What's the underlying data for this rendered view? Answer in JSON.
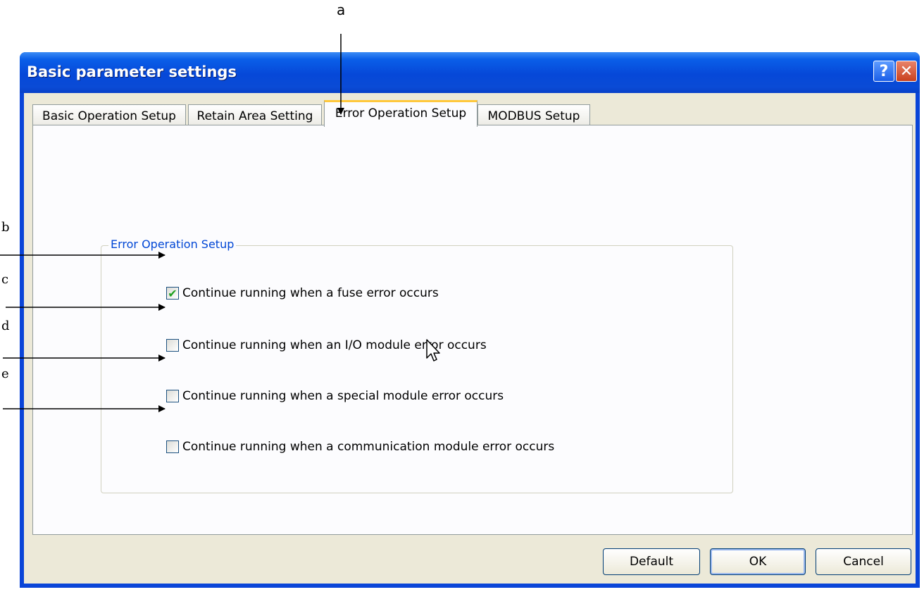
{
  "callouts": {
    "a": "a",
    "b": "b",
    "c": "c",
    "d": "d",
    "e": "e"
  },
  "window": {
    "title": "Basic parameter settings",
    "help_icon": "?",
    "close_icon": "✕"
  },
  "tabs": [
    {
      "label": "Basic Operation Setup",
      "active": false
    },
    {
      "label": "Retain Area Setting",
      "active": false
    },
    {
      "label": "Error Operation Setup",
      "active": true
    },
    {
      "label": "MODBUS Setup",
      "active": false
    }
  ],
  "group": {
    "title": "Error Operation Setup",
    "options": [
      {
        "label": "Continue running when a fuse error occurs",
        "checked": true
      },
      {
        "label": "Continue running when an I/O module error occurs",
        "checked": false
      },
      {
        "label": "Continue running when a special module error occurs",
        "checked": false
      },
      {
        "label": "Continue running when a communication module error occurs",
        "checked": false
      }
    ]
  },
  "buttons": {
    "default": "Default",
    "ok": "OK",
    "cancel": "Cancel"
  },
  "colors": {
    "titlebar": "#0a45d8",
    "dialog_face": "#ece9d8",
    "group_title": "#0046d5",
    "active_tab_highlight": "#ffc83c",
    "checkmark": "#21a121"
  }
}
